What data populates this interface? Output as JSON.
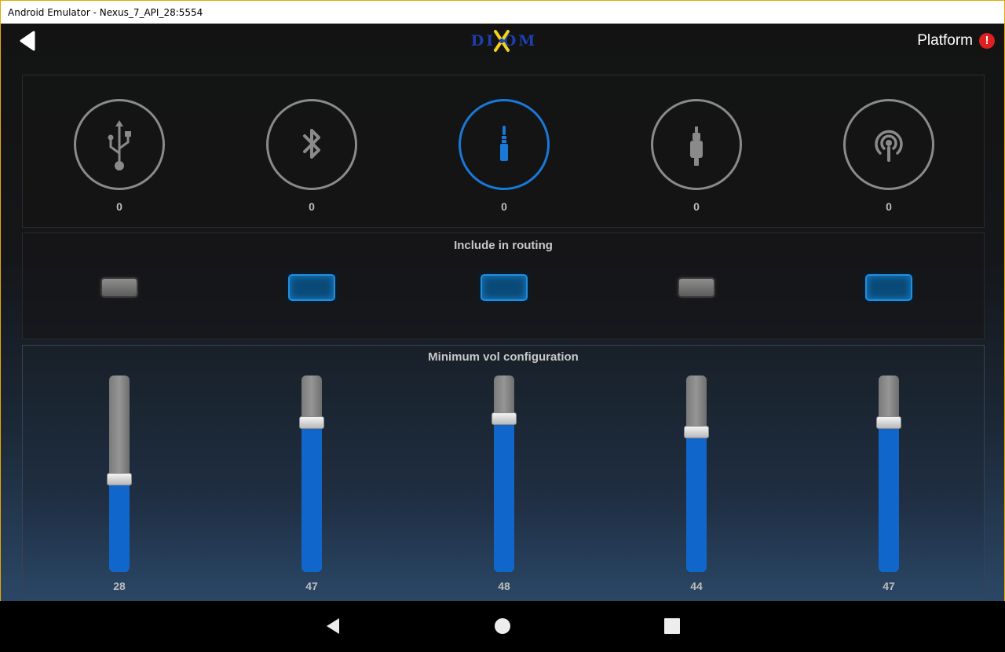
{
  "window": {
    "title": "Android Emulator - Nexus_7_API_28:5554"
  },
  "header": {
    "logo_text": "DI OM",
    "platform_label": "Platform",
    "alert_glyph": "!",
    "accent_color": "#1a78d8"
  },
  "sources": [
    {
      "icon": "usb-icon",
      "value": "0",
      "active": false
    },
    {
      "icon": "bluetooth-icon",
      "value": "0",
      "active": false
    },
    {
      "icon": "aux-jack-icon",
      "value": "0",
      "active": true
    },
    {
      "icon": "rca-plug-icon",
      "value": "0",
      "active": false
    },
    {
      "icon": "wireless-stream-icon",
      "value": "0",
      "active": false
    }
  ],
  "routing": {
    "title": "Include in routing",
    "toggles": [
      false,
      true,
      true,
      false,
      true
    ]
  },
  "volume": {
    "title": "Minimum vol configuration",
    "levels": [
      {
        "value": "28",
        "fraction": 0.47
      },
      {
        "value": "47",
        "fraction": 0.76
      },
      {
        "value": "48",
        "fraction": 0.78
      },
      {
        "value": "44",
        "fraction": 0.71
      },
      {
        "value": "47",
        "fraction": 0.76
      }
    ]
  }
}
